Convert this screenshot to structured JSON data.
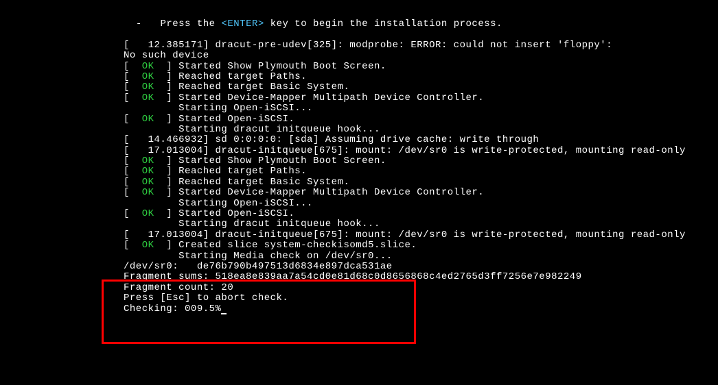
{
  "prompt": {
    "dash": "-",
    "press_the": "Press the",
    "enter_key": "<ENTER>",
    "rest": "key to begin the installation process."
  },
  "lines": [
    {
      "type": "timestamp",
      "text": "[   12.385171] dracut-pre-udev[325]: modprobe: ERROR: could not insert 'floppy':"
    },
    {
      "type": "plain",
      "text": "No such device"
    },
    {
      "type": "ok",
      "msg": "Started Show Plymouth Boot Screen."
    },
    {
      "type": "ok",
      "msg": "Reached target Paths."
    },
    {
      "type": "ok",
      "msg": "Reached target Basic System."
    },
    {
      "type": "ok",
      "msg": "Started Device-Mapper Multipath Device Controller."
    },
    {
      "type": "indent",
      "text": "         Starting Open-iSCSI..."
    },
    {
      "type": "ok",
      "msg": "Started Open-iSCSI."
    },
    {
      "type": "indent",
      "text": "         Starting dracut initqueue hook..."
    },
    {
      "type": "timestamp",
      "text": "[   14.466932] sd 0:0:0:0: [sda] Assuming drive cache: write through"
    },
    {
      "type": "timestamp",
      "text": "[   17.013004] dracut-initqueue[675]: mount: /dev/sr0 is write-protected, mounting read-only"
    },
    {
      "type": "ok",
      "msg": "Started Show Plymouth Boot Screen."
    },
    {
      "type": "ok",
      "msg": "Reached target Paths."
    },
    {
      "type": "ok",
      "msg": "Reached target Basic System."
    },
    {
      "type": "ok",
      "msg": "Started Device-Mapper Multipath Device Controller."
    },
    {
      "type": "indent",
      "text": "         Starting Open-iSCSI..."
    },
    {
      "type": "ok",
      "msg": "Started Open-iSCSI."
    },
    {
      "type": "indent",
      "text": "         Starting dracut initqueue hook..."
    },
    {
      "type": "timestamp",
      "text": "[   17.013004] dracut-initqueue[675]: mount: /dev/sr0 is write-protected, mounting read-only"
    },
    {
      "type": "ok",
      "msg": "Created slice system-checkisomd5.slice."
    },
    {
      "type": "indent",
      "text": "         Starting Media check on /dev/sr0..."
    },
    {
      "type": "plain",
      "text": "/dev/sr0:   de76b790b497513d6834e897dca531ae"
    },
    {
      "type": "plain",
      "text": "Fragment sums: 518ea8e839aa7a54cd0e81d68c0d8656868c4ed2765d3ff7256e7e982249"
    },
    {
      "type": "plain",
      "text": "Fragment count: 20"
    },
    {
      "type": "plain",
      "text": "Press [Esc] to abort check."
    },
    {
      "type": "checking",
      "prefix": "Checking: ",
      "percent": "009.5%"
    }
  ],
  "ok_label": "OK",
  "bracket_open": "[  ",
  "bracket_close": "  ] "
}
